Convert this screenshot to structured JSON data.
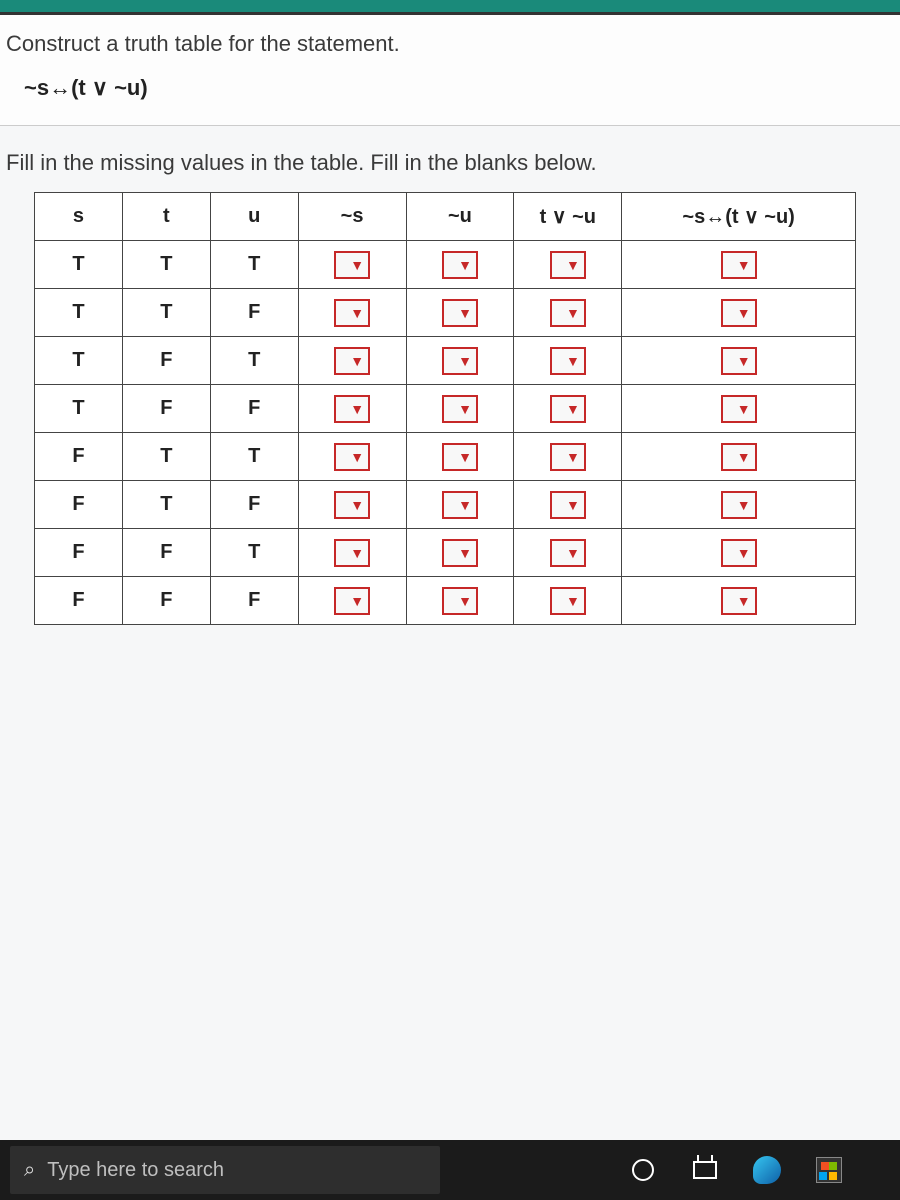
{
  "problem": {
    "title": "Construct a truth table for the statement.",
    "expression": "~s↔(t ∨ ~u)"
  },
  "fill_instruction": "Fill in the missing values in the table. Fill in the blanks below.",
  "table": {
    "headers": {
      "s": "s",
      "t": "t",
      "u": "u",
      "ns": "~s",
      "nu": "~u",
      "tvnu": "t ∨ ~u",
      "final": "~s↔(t ∨ ~u)"
    },
    "rows": [
      {
        "s": "T",
        "t": "T",
        "u": "T"
      },
      {
        "s": "T",
        "t": "T",
        "u": "F"
      },
      {
        "s": "T",
        "t": "F",
        "u": "T"
      },
      {
        "s": "T",
        "t": "F",
        "u": "F"
      },
      {
        "s": "F",
        "t": "T",
        "u": "T"
      },
      {
        "s": "F",
        "t": "T",
        "u": "F"
      },
      {
        "s": "F",
        "t": "F",
        "u": "T"
      },
      {
        "s": "F",
        "t": "F",
        "u": "F"
      }
    ]
  },
  "taskbar": {
    "search_placeholder": "Type here to search"
  }
}
